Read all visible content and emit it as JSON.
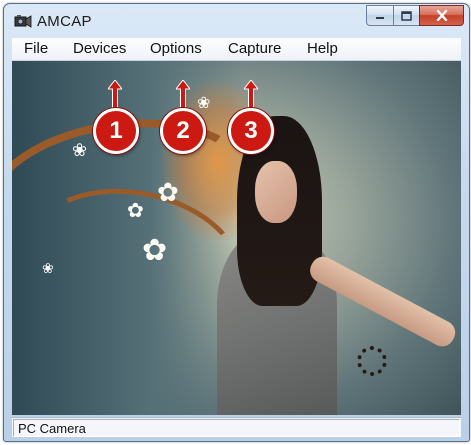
{
  "window": {
    "title": "AMCAP"
  },
  "menu": {
    "items": [
      {
        "label": "File"
      },
      {
        "label": "Devices"
      },
      {
        "label": "Options"
      },
      {
        "label": "Capture"
      },
      {
        "label": "Help"
      }
    ]
  },
  "callouts": [
    {
      "number": "1",
      "target": "Devices"
    },
    {
      "number": "2",
      "target": "Options"
    },
    {
      "number": "3",
      "target": "Capture"
    }
  ],
  "status": {
    "text": "PC Camera"
  },
  "colors": {
    "callout": "#cc1a12",
    "close_button": "#c4402a",
    "titlebar": "#c6daee"
  },
  "icons": {
    "app": "camera-icon",
    "minimize": "minimize-icon",
    "maximize": "maximize-icon",
    "close": "close-icon"
  }
}
